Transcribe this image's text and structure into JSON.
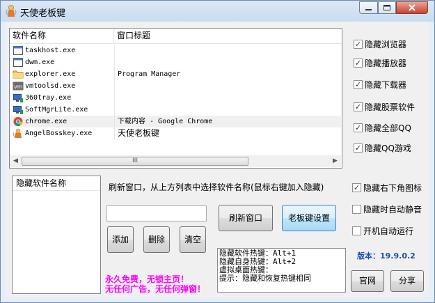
{
  "window": {
    "title": "天使老板键"
  },
  "process_list": {
    "columns": [
      "软件名称",
      "窗口标题"
    ],
    "rows": [
      {
        "name": "taskhost.exe",
        "title": "",
        "icon": "window-app-icon"
      },
      {
        "name": "dwm.exe",
        "title": "",
        "icon": "window-app-icon"
      },
      {
        "name": "explorer.exe",
        "title": "Program Manager",
        "icon": "folder-icon"
      },
      {
        "name": "vmtoolsd.exe",
        "title": "",
        "icon": "vm-icon"
      },
      {
        "name": "360tray.exe",
        "title": "",
        "icon": "monitor-app-icon"
      },
      {
        "name": "SoftMgrLite.exe",
        "title": "",
        "icon": "monitor-app-icon"
      },
      {
        "name": "chrome.exe",
        "title": "下载内容 - Google Chrome",
        "icon": "chrome-icon"
      },
      {
        "name": "AngelBosskey.exe",
        "title": "天使老板键",
        "icon": "angel-icon"
      }
    ],
    "scroll_grip": "III"
  },
  "hide_options": [
    {
      "label": "隐藏浏览器",
      "checked": true
    },
    {
      "label": "隐藏播放器",
      "checked": true
    },
    {
      "label": "隐藏下载器",
      "checked": true
    },
    {
      "label": "隐藏股票软件",
      "checked": true
    },
    {
      "label": "隐藏全部QQ",
      "checked": true
    },
    {
      "label": "隐藏QQ游戏",
      "checked": true
    }
  ],
  "hidden_list": {
    "header": "隐藏软件名称"
  },
  "hint_text": "刷新窗口，从上方列表中选择软件名称(鼠标右键加入隐藏)",
  "input": {
    "value": ""
  },
  "buttons": {
    "add": "添加",
    "delete": "删除",
    "clear": "清空",
    "refresh": "刷新窗口",
    "settings": "老板键设置",
    "website": "官网",
    "share": "分享"
  },
  "extra_options": [
    {
      "label": "隐藏右下角图标",
      "checked": true
    },
    {
      "label": "隐藏时自动静音",
      "checked": false
    },
    {
      "label": "开机自动运行",
      "checked": false
    }
  ],
  "hotkey_info": [
    "隐藏软件热键：Alt+1",
    "隐藏自身热键：Alt+2",
    "虚拟桌面热键：",
    "提示：隐藏和恢复热键相同"
  ],
  "version": {
    "label": "版本：19.9.0.2"
  },
  "promo": {
    "line1": "永久免费，无锁主页！",
    "line2": "无任何广告，无任何弹窗！",
    "color": "#ff00ff"
  },
  "colors": {
    "version_text": "#1c4fa8",
    "title_bar": "#c9dcf1",
    "close_button": "#c9422c"
  }
}
